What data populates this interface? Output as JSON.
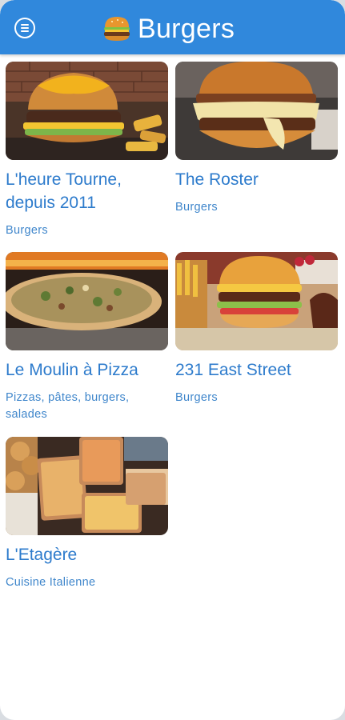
{
  "header": {
    "title": "Burgers",
    "title_emoji_icon": "burger-icon",
    "menu_icon": "hamburger-menu-icon",
    "bar_color": "#3088dc"
  },
  "restaurants": [
    {
      "name": "L'heure Tourne, depuis 2011",
      "category": "Burgers"
    },
    {
      "name": "The Roster",
      "category": "Burgers"
    },
    {
      "name": "Le Moulin à Pizza",
      "category": "Pizzas, pâtes, burgers, salades"
    },
    {
      "name": "231 East Street",
      "category": "Burgers"
    },
    {
      "name": "L'Etagère",
      "category": "Cuisine Italienne"
    }
  ],
  "colors": {
    "name": "#2d7bcc",
    "category": "#3f86cb"
  }
}
